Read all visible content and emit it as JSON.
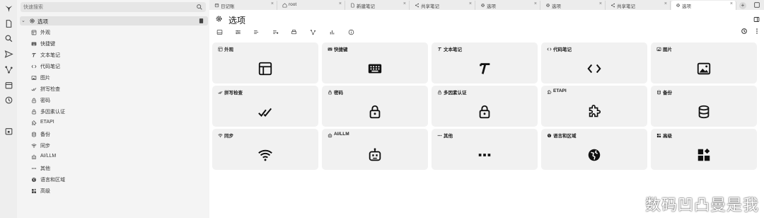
{
  "search": {
    "placeholder": "快速搜索"
  },
  "tree": {
    "root_label": "选项",
    "items": [
      {
        "label": "外观",
        "icon": "layout-icon"
      },
      {
        "label": "快捷键",
        "icon": "keyboard-icon"
      },
      {
        "label": "文本笔记",
        "icon": "text-icon"
      },
      {
        "label": "代码笔记",
        "icon": "code-icon"
      },
      {
        "label": "图片",
        "icon": "image-icon"
      },
      {
        "label": "拼写检查",
        "icon": "spellcheck-icon"
      },
      {
        "label": "密码",
        "icon": "lock-icon"
      },
      {
        "label": "多因素认证",
        "icon": "lock-icon"
      },
      {
        "label": "ETAPI",
        "icon": "extension-icon"
      },
      {
        "label": "备份",
        "icon": "database-icon"
      },
      {
        "label": "同步",
        "icon": "wifi-icon"
      },
      {
        "label": "AI/LLM",
        "icon": "bot-icon"
      },
      {
        "label": "其他",
        "icon": "more-icon"
      },
      {
        "label": "语言和区域",
        "icon": "globe-icon"
      },
      {
        "label": "高级",
        "icon": "apps-icon"
      }
    ]
  },
  "tabs": [
    {
      "label": "日记账",
      "icon": "calendar-icon",
      "active": false
    },
    {
      "label": "root",
      "icon": "home-icon",
      "active": false
    },
    {
      "label": "新建笔记",
      "icon": "note-icon",
      "active": false
    },
    {
      "label": "共享笔记",
      "icon": "share-icon",
      "active": false
    },
    {
      "label": "选项",
      "icon": "gear-icon",
      "active": false
    },
    {
      "label": "选项",
      "icon": "gear-icon",
      "active": false
    },
    {
      "label": "共享笔记",
      "icon": "share-icon",
      "active": false
    },
    {
      "label": "选项",
      "icon": "gear-icon",
      "active": true
    }
  ],
  "tab_close_glyph": "×",
  "tab_add_glyph": "+",
  "main": {
    "title": "选项"
  },
  "cards": [
    {
      "label": "外观",
      "icon": "layout-icon"
    },
    {
      "label": "快捷键",
      "icon": "keyboard-icon"
    },
    {
      "label": "文本笔记",
      "icon": "text-icon"
    },
    {
      "label": "代码笔记",
      "icon": "code-icon"
    },
    {
      "label": "图片",
      "icon": "image-icon"
    },
    {
      "label": "拼写检查",
      "icon": "spellcheck-icon"
    },
    {
      "label": "密码",
      "icon": "lock-icon"
    },
    {
      "label": "多因素认证",
      "icon": "lock-icon"
    },
    {
      "label": "ETAPI",
      "icon": "extension-icon"
    },
    {
      "label": "备份",
      "icon": "database-icon"
    },
    {
      "label": "同步",
      "icon": "wifi-icon"
    },
    {
      "label": "AI/LLM",
      "icon": "bot-icon"
    },
    {
      "label": "其他",
      "icon": "more-icon"
    },
    {
      "label": "语言和区域",
      "icon": "globe-icon"
    },
    {
      "label": "高级",
      "icon": "apps-icon"
    }
  ],
  "watermark": "数码凹凸曼是我",
  "colors": {
    "rail_bg": "#eeeeee",
    "tree_bg": "#f4f4f4",
    "card_bg": "#f1f1f1",
    "tabbar_bg": "#ececec"
  }
}
